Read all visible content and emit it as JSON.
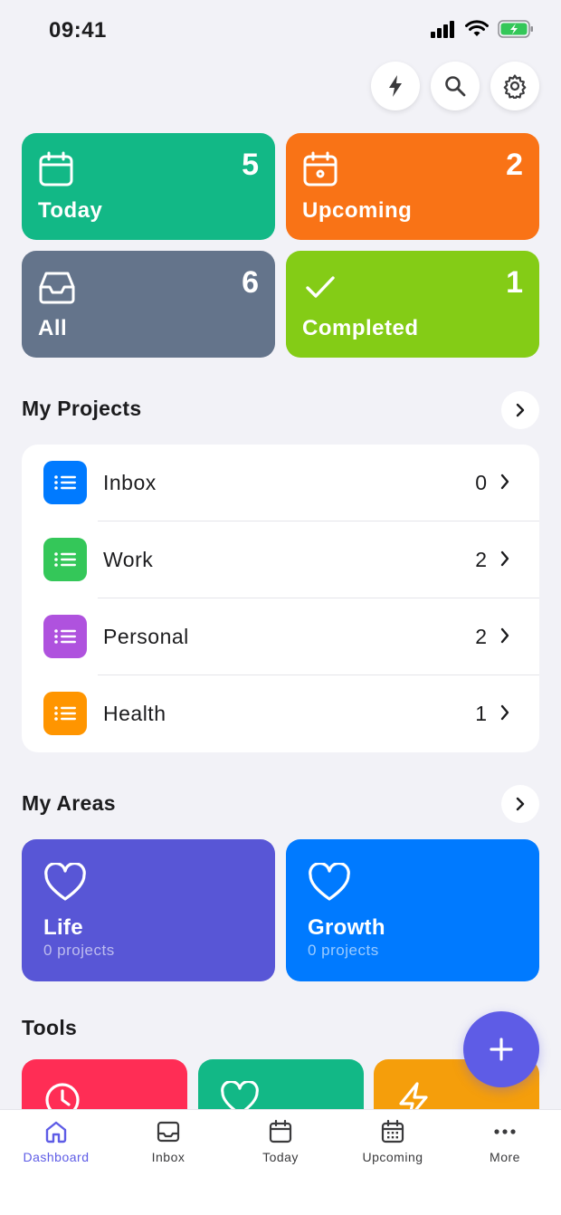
{
  "status_bar": {
    "time": "09:41"
  },
  "summary": [
    {
      "label": "Today",
      "count": "5",
      "color": "#12b886",
      "icon": "calendar-icon"
    },
    {
      "label": "Upcoming",
      "count": "2",
      "color": "#f97316",
      "icon": "calendar-dot-icon"
    },
    {
      "label": "All",
      "count": "6",
      "color": "#64748b",
      "icon": "inbox-icon"
    },
    {
      "label": "Completed",
      "count": "1",
      "color": "#84cc16",
      "icon": "checkmark-icon"
    }
  ],
  "projects": {
    "title": "My Projects",
    "items": [
      {
        "name": "Inbox",
        "count": "0",
        "color": "#007aff"
      },
      {
        "name": "Work",
        "count": "2",
        "color": "#34c759"
      },
      {
        "name": "Personal",
        "count": "2",
        "color": "#af52de"
      },
      {
        "name": "Health",
        "count": "1",
        "color": "#ff9500"
      }
    ]
  },
  "areas": {
    "title": "My Areas",
    "items": [
      {
        "name": "Life",
        "sub": "0 projects",
        "color": "#5856d6"
      },
      {
        "name": "Growth",
        "sub": "0 projects",
        "color": "#007aff"
      }
    ]
  },
  "tools": {
    "title": "Tools",
    "items": [
      {
        "icon": "clock-icon",
        "color": "#ff2d55"
      },
      {
        "icon": "heart-icon",
        "color": "#12b886"
      },
      {
        "icon": "lightning-icon",
        "color": "#f59e0b"
      }
    ]
  },
  "tab_bar": [
    {
      "label": "Dashboard",
      "active": true
    },
    {
      "label": "Inbox",
      "active": false
    },
    {
      "label": "Today",
      "active": false
    },
    {
      "label": "Upcoming",
      "active": false
    },
    {
      "label": "More",
      "active": false
    }
  ],
  "colors": {
    "accent": "#5e5ce6",
    "background": "#f2f2f7"
  }
}
